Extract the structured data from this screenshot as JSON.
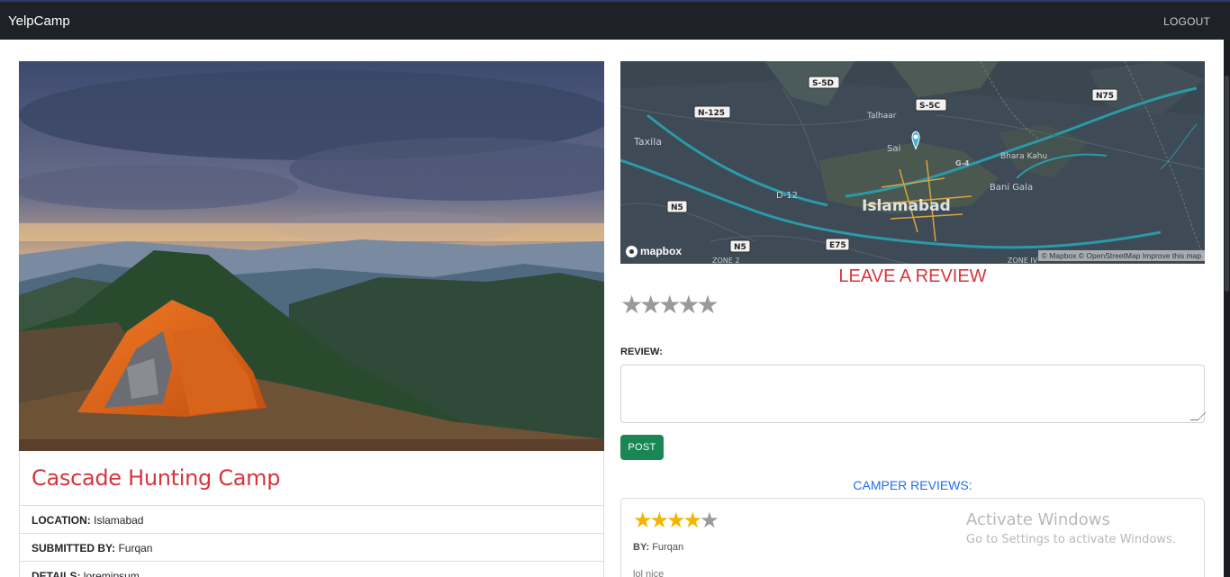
{
  "nav": {
    "brand": "YelpCamp",
    "logout": "LOGOUT"
  },
  "camp": {
    "title": "Cascade Hunting Camp",
    "location_label": "LOCATION:",
    "location": "Islamabad",
    "submitted_label": "SUBMITTED BY:",
    "submitted_by": "Furqan",
    "details_label": "DETAILS:",
    "details": "loremipsum"
  },
  "map": {
    "labels": {
      "s5d": "S-5D",
      "n125": "N-125",
      "s5c": "S-5C",
      "n75": "N75",
      "talhaar": "Talhaar",
      "taxila": "Taxila",
      "saidpur": "Sai",
      "g4": "G-4",
      "bhara_kahu": "Bhara Kahu",
      "d12": "D-12",
      "bani_gala": "Bani Gala",
      "islamabad": "Islamabad",
      "n5a": "N5",
      "n5b": "N5",
      "e75": "E75",
      "zone2": "ZONE 2",
      "zone4": "ZONE IV"
    },
    "logo": "mapbox",
    "attribution": "© Mapbox © OpenStreetMap  Improve this map"
  },
  "review_form": {
    "heading": "LEAVE A REVIEW",
    "stars": "★★★★★",
    "review_label": "REVIEW:",
    "post_button": "POST"
  },
  "reviews": {
    "heading": "CAMPER REVIEWS:",
    "items": [
      {
        "rating": 4,
        "stars_on": "★★★★",
        "stars_off": "★",
        "by_label": "BY:",
        "author": "Furqan",
        "body": "lol nice"
      }
    ]
  },
  "watermark": {
    "title": "Activate Windows",
    "subtitle": "Go to Settings to activate Windows."
  },
  "colors": {
    "navbar": "#1e2227",
    "title_red": "#d6353c",
    "post_green": "#198754",
    "reviews_blue": "#1f6ff0",
    "star_gold": "#f4b400"
  }
}
